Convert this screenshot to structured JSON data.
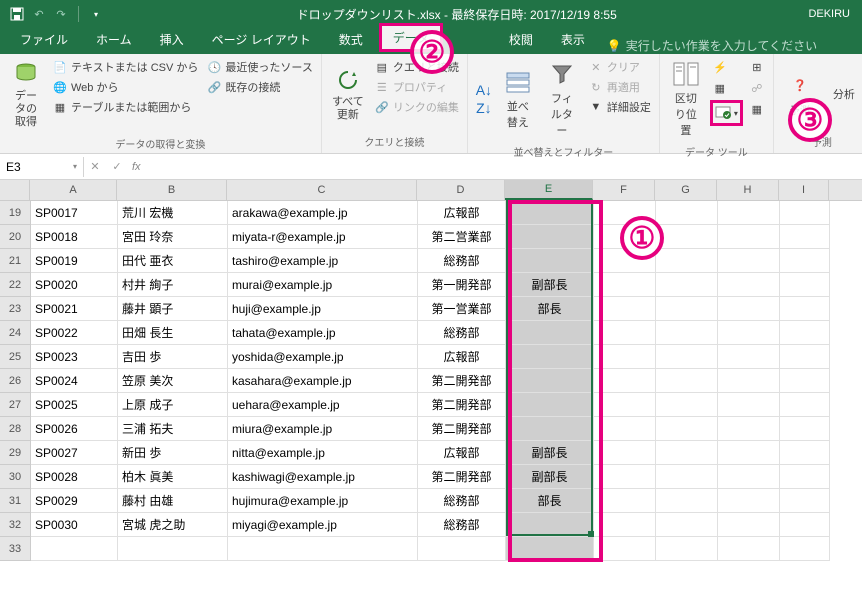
{
  "title": "ドロップダウンリスト.xlsx - 最終保存日時: 2017/12/19 8:55",
  "user_label": "DEKIRU",
  "tabs": [
    "ファイル",
    "ホーム",
    "挿入",
    "ページ レイアウト",
    "数式",
    "データ",
    "校閲",
    "表示"
  ],
  "tellme_placeholder": "実行したい作業を入力してください",
  "ribbon": {
    "g1": {
      "btn": "データの\n取得",
      "items": [
        "テキストまたは CSV から",
        "Web から",
        "テーブルまたは範囲から",
        "最近使ったソース",
        "既存の接続"
      ],
      "label": "データの取得と変換"
    },
    "g2": {
      "btn": "すべて\n更新",
      "items": [
        "クエリと接続",
        "プロパティ",
        "リンクの編集"
      ],
      "label": "クエリと接続"
    },
    "g3": {
      "btn1": "並べ替え",
      "btn2": "フィルター",
      "items": [
        "クリア",
        "再適用",
        "詳細設定"
      ],
      "label": "並べ替えとフィルター"
    },
    "g4": {
      "btn1": "区切り位置",
      "label": "データ ツール"
    },
    "g5": {
      "items": [
        "予測",
        "分析"
      ],
      "label": "予測"
    }
  },
  "namebox": "E3",
  "columns": [
    "A",
    "B",
    "C",
    "D",
    "E",
    "F",
    "G",
    "H",
    "I"
  ],
  "row_nums": [
    19,
    20,
    21,
    22,
    23,
    24,
    25,
    26,
    27,
    28,
    29,
    30,
    31,
    32,
    33
  ],
  "rows": [
    {
      "a": "SP0017",
      "b": "荒川 宏機",
      "c": "arakawa@example.jp",
      "d": "広報部",
      "e": ""
    },
    {
      "a": "SP0018",
      "b": "宮田 玲奈",
      "c": "miyata-r@example.jp",
      "d": "第二営業部",
      "e": ""
    },
    {
      "a": "SP0019",
      "b": "田代 亜衣",
      "c": "tashiro@example.jp",
      "d": "総務部",
      "e": ""
    },
    {
      "a": "SP0020",
      "b": "村井 絢子",
      "c": "murai@example.jp",
      "d": "第一開発部",
      "e": "副部長"
    },
    {
      "a": "SP0021",
      "b": "藤井 顕子",
      "c": "huji@example.jp",
      "d": "第一営業部",
      "e": "部長"
    },
    {
      "a": "SP0022",
      "b": "田畑 長生",
      "c": "tahata@example.jp",
      "d": "総務部",
      "e": ""
    },
    {
      "a": "SP0023",
      "b": "吉田 歩",
      "c": "yoshida@example.jp",
      "d": "広報部",
      "e": ""
    },
    {
      "a": "SP0024",
      "b": "笠原 美次",
      "c": "kasahara@example.jp",
      "d": "第二開発部",
      "e": ""
    },
    {
      "a": "SP0025",
      "b": "上原 成子",
      "c": "uehara@example.jp",
      "d": "第二開発部",
      "e": ""
    },
    {
      "a": "SP0026",
      "b": "三浦 拓夫",
      "c": "miura@example.jp",
      "d": "第二開発部",
      "e": ""
    },
    {
      "a": "SP0027",
      "b": "新田 歩",
      "c": "nitta@example.jp",
      "d": "広報部",
      "e": "副部長"
    },
    {
      "a": "SP0028",
      "b": "柏木 眞美",
      "c": "kashiwagi@example.jp",
      "d": "第二開発部",
      "e": "副部長"
    },
    {
      "a": "SP0029",
      "b": "藤村 由雄",
      "c": "hujimura@example.jp",
      "d": "総務部",
      "e": "部長"
    },
    {
      "a": "SP0030",
      "b": "宮城 虎之助",
      "c": "miyagi@example.jp",
      "d": "総務部",
      "e": ""
    }
  ],
  "annotations": {
    "1": "①",
    "2": "②",
    "3": "③"
  }
}
